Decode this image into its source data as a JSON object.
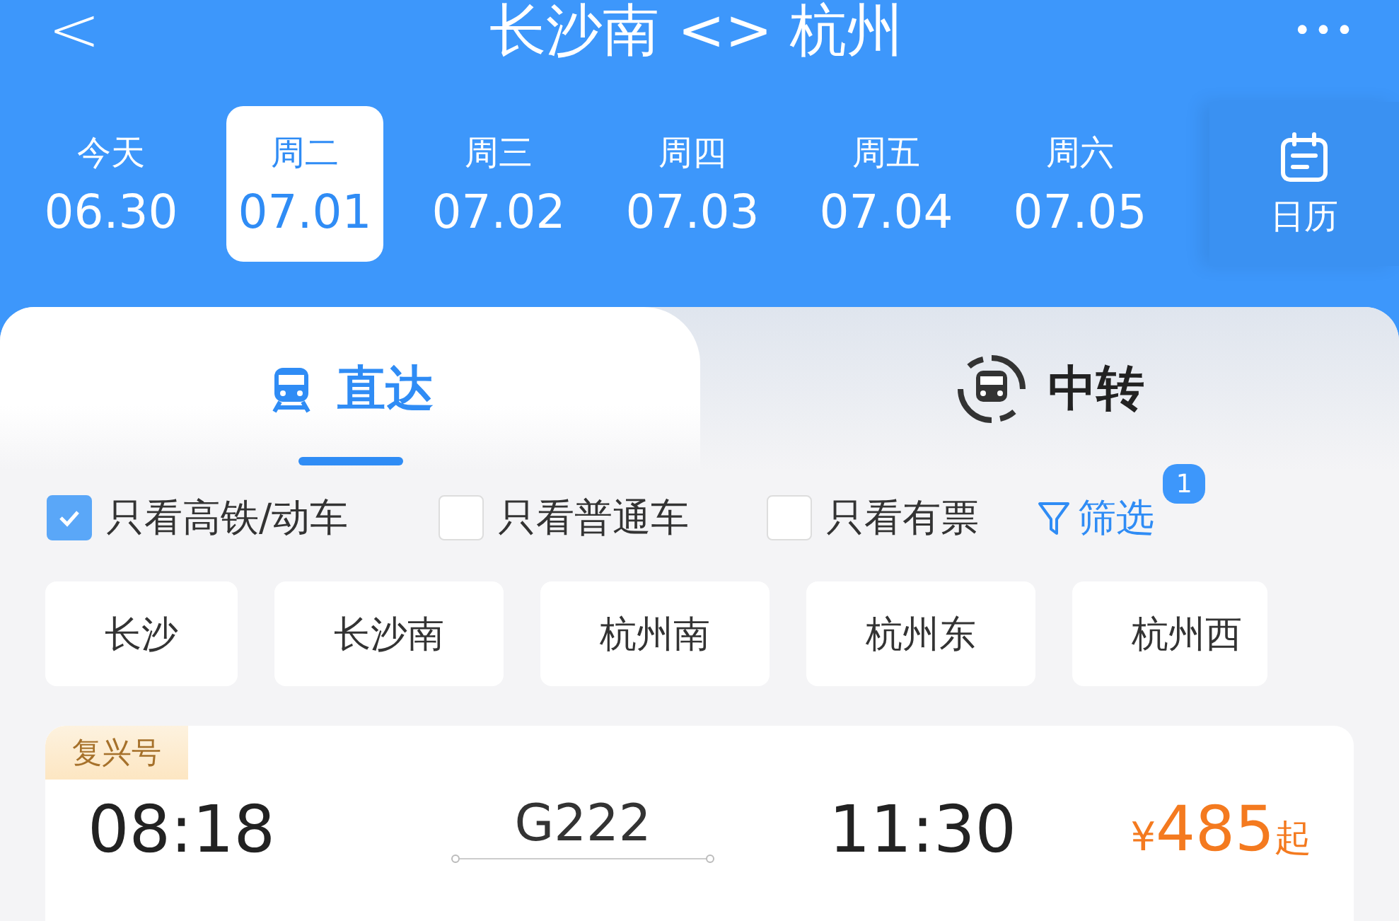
{
  "header": {
    "back": "<",
    "title": "长沙南 <> 杭州",
    "more": "•••"
  },
  "dates": [
    {
      "weekday": "今天",
      "date": "06.30",
      "selected": false
    },
    {
      "weekday": "周二",
      "date": "07.01",
      "selected": true
    },
    {
      "weekday": "周三",
      "date": "07.02",
      "selected": false
    },
    {
      "weekday": "周四",
      "date": "07.03",
      "selected": false
    },
    {
      "weekday": "周五",
      "date": "07.04",
      "selected": false
    },
    {
      "weekday": "周六",
      "date": "07.05",
      "selected": false
    }
  ],
  "calendar": {
    "label": "日历"
  },
  "tabs": [
    {
      "label": "直达",
      "kind": "direct",
      "selected": true
    },
    {
      "label": "中转",
      "kind": "transfer",
      "selected": false
    }
  ],
  "filters": [
    {
      "label": "只看高铁/动车",
      "checked": true
    },
    {
      "label": "只看普通车",
      "checked": false
    },
    {
      "label": "只看有票",
      "checked": false
    }
  ],
  "filter_button": {
    "label": "筛选",
    "badge": "1"
  },
  "stations": [
    "长沙",
    "长沙南",
    "杭州南",
    "杭州东",
    "杭州西"
  ],
  "trains": [
    {
      "type": "复兴号",
      "depart": "08:18",
      "number": "G222",
      "arrive": "11:30",
      "currency": "¥",
      "price": "485",
      "suffix": "起"
    }
  ]
}
